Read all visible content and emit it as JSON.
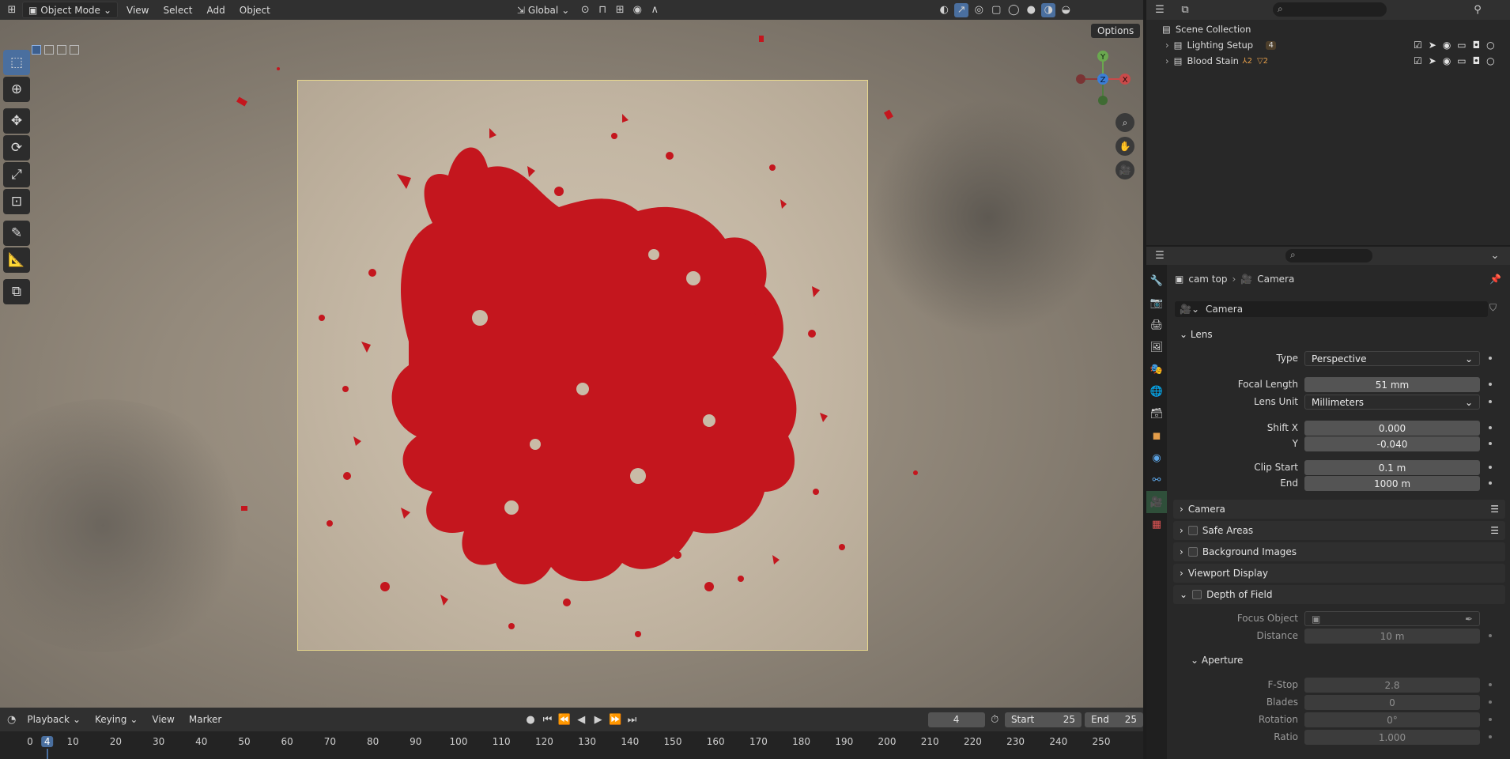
{
  "header": {
    "mode": "Object Mode",
    "menus": [
      "View",
      "Select",
      "Add",
      "Object"
    ],
    "orientation": "Global",
    "options": "Options"
  },
  "viewport": {
    "gizmo": {
      "y": "Y",
      "z": "Z",
      "x": "X"
    }
  },
  "timeline": {
    "menus": [
      "Playback",
      "Keying",
      "View",
      "Marker"
    ],
    "current_frame": "4",
    "start_label": "Start",
    "start_value": "25",
    "end_label": "End",
    "end_value": "25",
    "ruler": [
      "0",
      "4",
      "10",
      "20",
      "30",
      "40",
      "50",
      "60",
      "70",
      "80",
      "90",
      "100",
      "110",
      "120",
      "130",
      "140",
      "150",
      "160",
      "170",
      "180",
      "190",
      "200",
      "210",
      "220",
      "230",
      "240",
      "250"
    ]
  },
  "outliner": {
    "root": "Scene Collection",
    "items": [
      {
        "label": "Lighting Setup",
        "badge": "4"
      },
      {
        "label": "Blood Stain",
        "badge1": "2",
        "badge2": "2"
      }
    ]
  },
  "properties": {
    "breadcrumb": {
      "object": "cam top",
      "data": "Camera"
    },
    "datablock": "Camera",
    "lens": {
      "title": "Lens",
      "type_label": "Type",
      "type": "Perspective",
      "focal_label": "Focal Length",
      "focal": "51 mm",
      "unit_label": "Lens Unit",
      "unit": "Millimeters",
      "shiftx_label": "Shift X",
      "shiftx": "0.000",
      "shifty_label": "Y",
      "shifty": "-0.040",
      "clipstart_label": "Clip Start",
      "clipstart": "0.1 m",
      "clipend_label": "End",
      "clipend": "1000 m"
    },
    "panels": [
      "Camera",
      "Safe Areas",
      "Background Images",
      "Viewport Display",
      "Depth of Field"
    ],
    "dof": {
      "focus_label": "Focus Object",
      "distance_label": "Distance",
      "distance": "10 m",
      "aperture": "Aperture",
      "fstop_label": "F-Stop",
      "fstop": "2.8",
      "blades_label": "Blades",
      "blades": "0",
      "rotation_label": "Rotation",
      "rotation": "0°",
      "ratio_label": "Ratio",
      "ratio": "1.000"
    }
  },
  "colors": {
    "accent": "#4a6f9f",
    "blood": "#c4161e",
    "frame": "#e9d98e"
  }
}
